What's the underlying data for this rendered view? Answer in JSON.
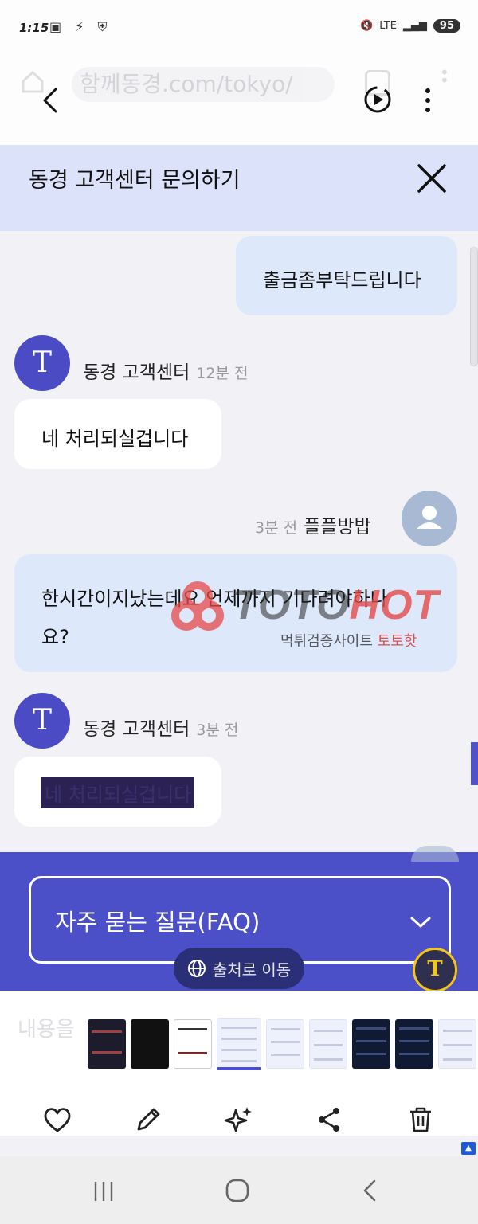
{
  "status_bar": {
    "time": "1:15",
    "network": "LTE",
    "battery": "95"
  },
  "browser": {
    "url": "함께동경.com/tokyo/"
  },
  "chat": {
    "title": "동경 고객센터 문의하기",
    "messages": [
      {
        "sender": "user",
        "text": "출금좀부탁드립니다"
      },
      {
        "sender": "agent",
        "name": "동경 고객센터",
        "time": "12분 전",
        "text": "네 처리되실겁니다"
      },
      {
        "sender": "user",
        "name": "플플방밥",
        "time": "3분 전",
        "text": "한시간이지났는데요 언제까지 기다려야하나요?"
      },
      {
        "sender": "agent",
        "name": "동경 고객센터",
        "time": "3분 전",
        "text": "네 처리되실겁니다"
      }
    ],
    "agent_avatar_letter": "T"
  },
  "watermark": {
    "brand_left": "TOTO",
    "brand_right": "HOT",
    "subtitle_left": "먹튀검증사이트",
    "subtitle_right": "토토핫"
  },
  "faq": {
    "label": "자주 묻는 질문(FAQ)"
  },
  "viewer": {
    "source_button": "출처로 이동",
    "ocr_letter": "T",
    "ghost_input": "내용을"
  },
  "colors": {
    "accent": "#4b4fc8",
    "header_bg": "#dde2fb",
    "user_bubble": "#dde9fb",
    "agent_avatar": "#4b4bc5",
    "watermark_red": "#e54949"
  },
  "icons": {
    "back": "chevron-left-icon",
    "motion": "motion-photo-icon",
    "more": "more-vertical-icon",
    "close": "close-icon",
    "chevron": "chevron-down-icon",
    "globe": "globe-icon",
    "favorite": "heart-icon",
    "edit": "pencil-icon",
    "ai": "sparkle-icon",
    "share": "share-icon",
    "delete": "trash-icon"
  }
}
